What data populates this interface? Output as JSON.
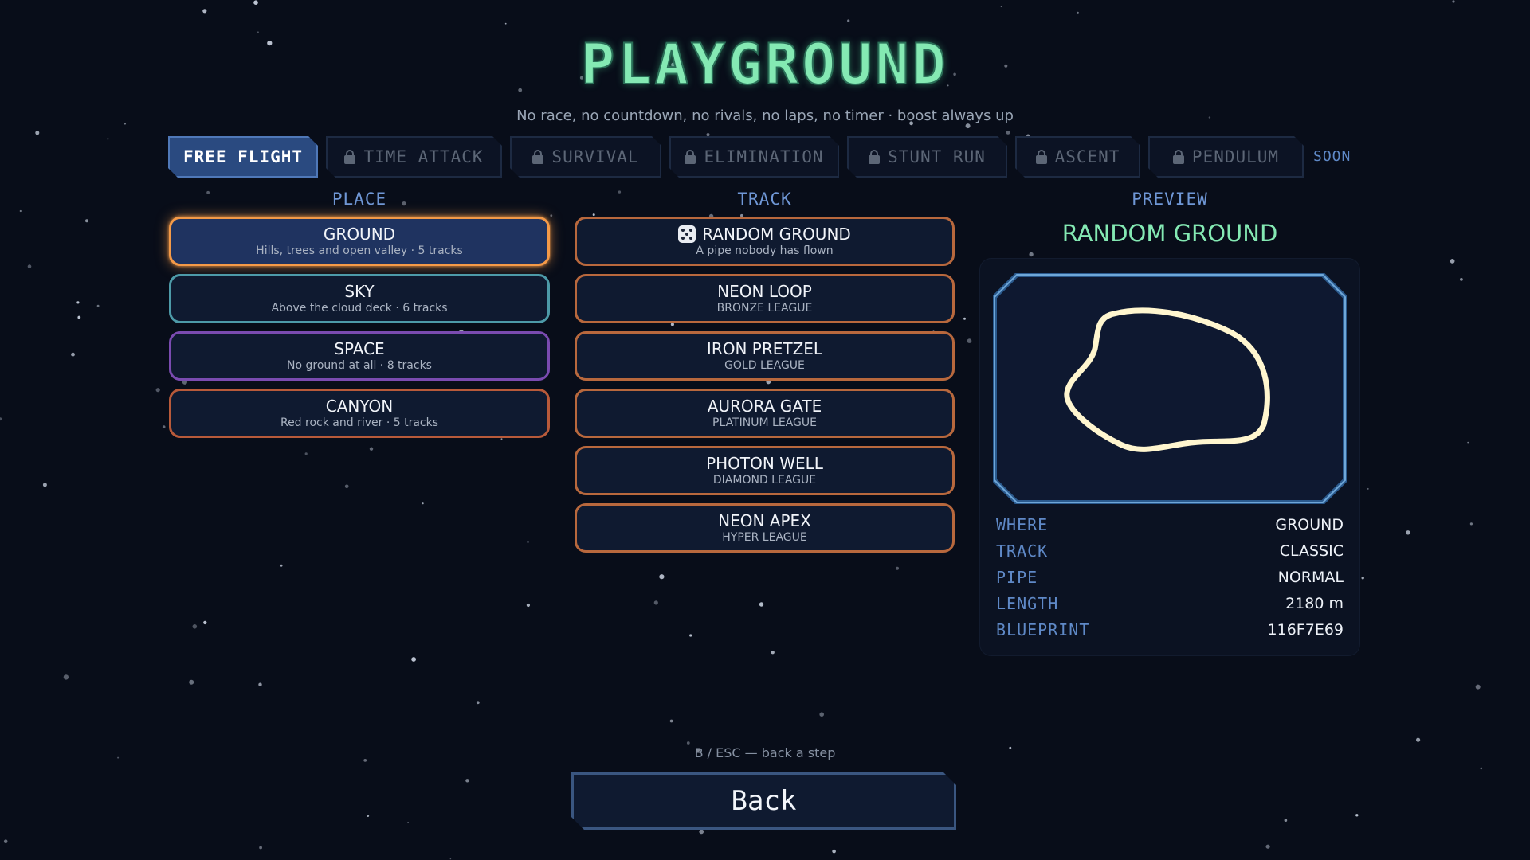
{
  "title": "PLAYGROUND",
  "subtitle": "No race, no countdown, no rivals, no laps, no timer · boost always up",
  "modes": [
    {
      "label": "FREE FLIGHT",
      "locked": false
    },
    {
      "label": "TIME ATTACK",
      "locked": true
    },
    {
      "label": "SURVIVAL",
      "locked": true
    },
    {
      "label": "ELIMINATION",
      "locked": true
    },
    {
      "label": "STUNT RUN",
      "locked": true
    },
    {
      "label": "ASCENT",
      "locked": true
    },
    {
      "label": "PENDULUM",
      "locked": true
    }
  ],
  "soon_label": "SOON",
  "columns": {
    "place": "PLACE",
    "track": "TRACK",
    "preview": "PREVIEW"
  },
  "places": [
    {
      "name": "GROUND",
      "desc": "Hills, trees and open valley · 5 tracks"
    },
    {
      "name": "SKY",
      "desc": "Above the cloud deck · 6 tracks"
    },
    {
      "name": "SPACE",
      "desc": "No ground at all · 8 tracks"
    },
    {
      "name": "CANYON",
      "desc": "Red rock and river · 5 tracks"
    }
  ],
  "tracks": [
    {
      "name": "RANDOM GROUND",
      "desc": "A pipe nobody has flown",
      "icon": "dice-icon"
    },
    {
      "name": "NEON LOOP",
      "desc": "BRONZE LEAGUE"
    },
    {
      "name": "IRON PRETZEL",
      "desc": "GOLD LEAGUE"
    },
    {
      "name": "AURORA GATE",
      "desc": "PLATINUM LEAGUE"
    },
    {
      "name": "PHOTON WELL",
      "desc": "DIAMOND LEAGUE"
    },
    {
      "name": "NEON APEX",
      "desc": "HYPER LEAGUE"
    }
  ],
  "preview": {
    "name": "RANDOM GROUND",
    "stats": [
      {
        "label": "WHERE",
        "value": "GROUND"
      },
      {
        "label": "TRACK",
        "value": "CLASSIC"
      },
      {
        "label": "PIPE",
        "value": "NORMAL"
      },
      {
        "label": "LENGTH",
        "value": "2180 m"
      },
      {
        "label": "BLUEPRINT",
        "value": "116F7E69"
      }
    ],
    "track_color": "#fff6cf"
  },
  "hint": "B / ESC — back a step",
  "back_label": "Back",
  "colors": {
    "accent_green": "#84e9b3",
    "accent_blue": "#5f89c7",
    "selected_orange": "#f49a48"
  }
}
